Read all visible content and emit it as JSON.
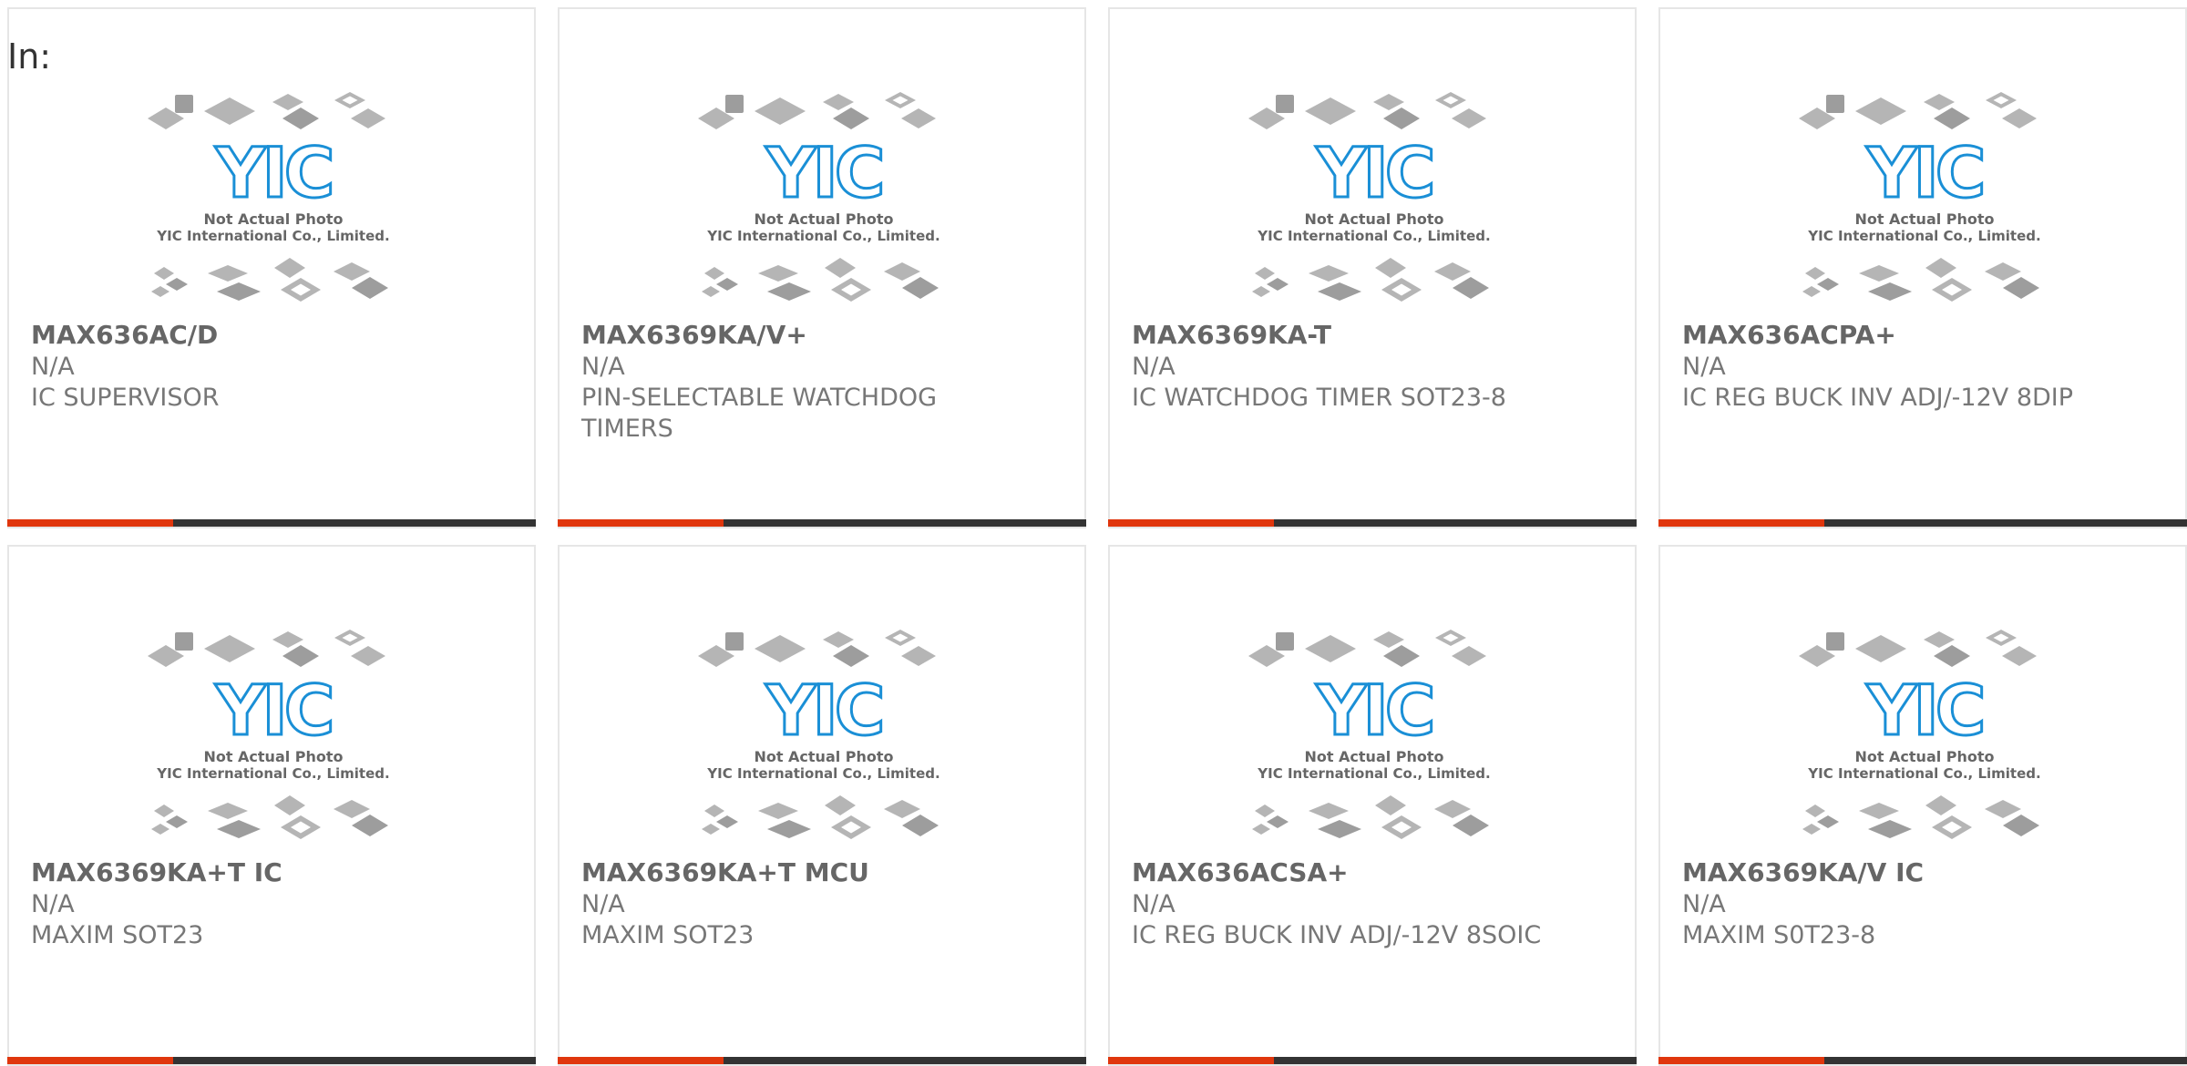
{
  "page": {
    "in_label": "In:"
  },
  "placeholder_image": {
    "line1": "Not Actual Photo",
    "line2": "YIC International Co., Limited.",
    "logo_text": "YIC"
  },
  "colors": {
    "accent": "#e0360d",
    "bar": "#333333",
    "logo_blue": "#1a8fd6",
    "chip_gray": "#b5b5b5"
  },
  "products": [
    {
      "part": "MAX636AC/D",
      "mfr": "N/A",
      "desc": "IC SUPERVISOR"
    },
    {
      "part": "MAX6369KA/V+",
      "mfr": "N/A",
      "desc": "PIN-SELECTABLE WATCHDOG TIMERS"
    },
    {
      "part": "MAX6369KA-T",
      "mfr": "N/A",
      "desc": "IC WATCHDOG TIMER SOT23-8"
    },
    {
      "part": "MAX636ACPA+",
      "mfr": "N/A",
      "desc": "IC REG BUCK INV ADJ/-12V 8DIP"
    },
    {
      "part": "MAX6369KA+T IC",
      "mfr": "N/A",
      "desc": "MAXIM SOT23"
    },
    {
      "part": "MAX6369KA+T MCU",
      "mfr": "N/A",
      "desc": "MAXIM SOT23"
    },
    {
      "part": "MAX636ACSA+",
      "mfr": "N/A",
      "desc": "IC REG BUCK INV ADJ/-12V 8SOIC"
    },
    {
      "part": "MAX6369KA/V IC",
      "mfr": "N/A",
      "desc": "MAXIM S0T23-8"
    }
  ]
}
